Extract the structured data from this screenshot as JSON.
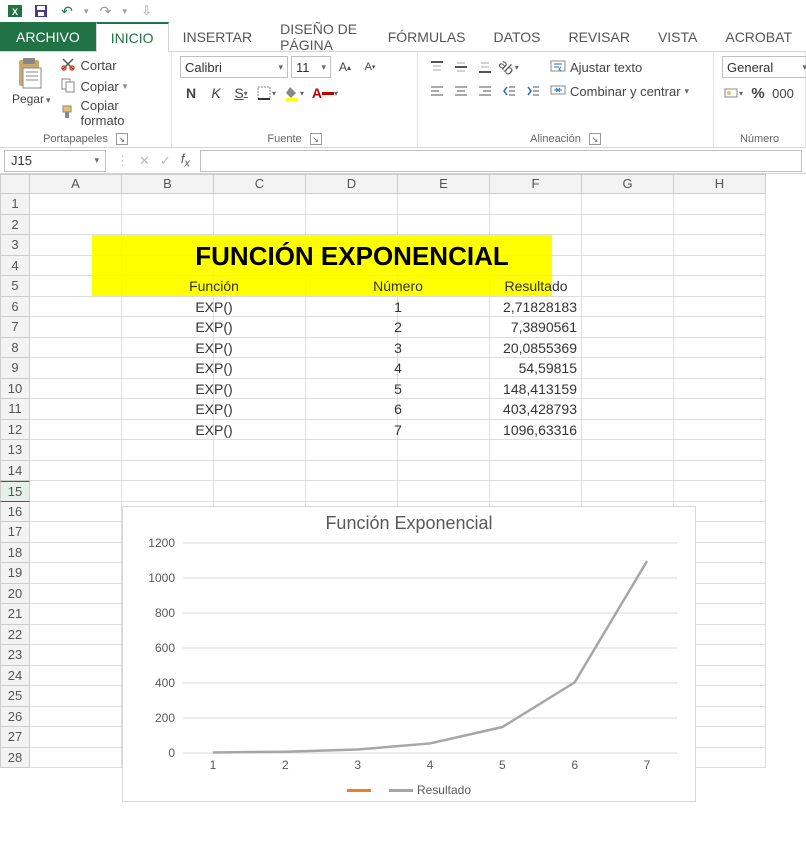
{
  "qat": {
    "undo": "↶",
    "redo": "↷"
  },
  "tabs": {
    "file": "ARCHIVO",
    "home": "INICIO",
    "insert": "INSERTAR",
    "pagelayout": "DISEÑO DE PÁGINA",
    "formulas": "FÓRMULAS",
    "data": "DATOS",
    "review": "REVISAR",
    "view": "VISTA",
    "acrobat": "ACROBAT"
  },
  "ribbon": {
    "clipboard": {
      "paste": "Pegar",
      "cut": "Cortar",
      "copy": "Copiar",
      "format_painter": "Copiar formato",
      "label": "Portapapeles"
    },
    "font": {
      "name": "Calibri",
      "size": "11",
      "bold": "N",
      "italic": "K",
      "underline": "S",
      "label": "Fuente"
    },
    "alignment": {
      "wrap": "Ajustar texto",
      "merge": "Combinar y centrar",
      "label": "Alineación"
    },
    "number": {
      "format": "General",
      "label": "Número"
    }
  },
  "namebox": "J15",
  "columns": [
    "A",
    "B",
    "C",
    "D",
    "E",
    "F",
    "G",
    "H"
  ],
  "yellow": {
    "title": "FUNCIÓN EXPONENCIAL",
    "h1": "Función",
    "h2": "Número",
    "h3": "Resultado"
  },
  "table": {
    "rows": [
      {
        "func": "EXP()",
        "num": "1",
        "res": "2,71828183"
      },
      {
        "func": "EXP()",
        "num": "2",
        "res": "7,3890561"
      },
      {
        "func": "EXP()",
        "num": "3",
        "res": "20,0855369"
      },
      {
        "func": "EXP()",
        "num": "4",
        "res": "54,59815"
      },
      {
        "func": "EXP()",
        "num": "5",
        "res": "148,413159"
      },
      {
        "func": "EXP()",
        "num": "6",
        "res": "403,428793"
      },
      {
        "func": "EXP()",
        "num": "7",
        "res": "1096,63316"
      }
    ]
  },
  "chart_data": {
    "type": "line",
    "title": "Función Exponencial",
    "categories": [
      "1",
      "2",
      "3",
      "4",
      "5",
      "6",
      "7"
    ],
    "series": [
      {
        "name": "",
        "values": [],
        "color": "#ed7d31"
      },
      {
        "name": "Resultado",
        "values": [
          2.71828183,
          7.3890561,
          20.0855369,
          54.59815,
          148.413159,
          403.428793,
          1096.63316
        ],
        "color": "#a6a6a6"
      }
    ],
    "yticks": [
      0,
      200,
      400,
      600,
      800,
      1000,
      1200
    ],
    "ylim": [
      0,
      1200
    ]
  }
}
